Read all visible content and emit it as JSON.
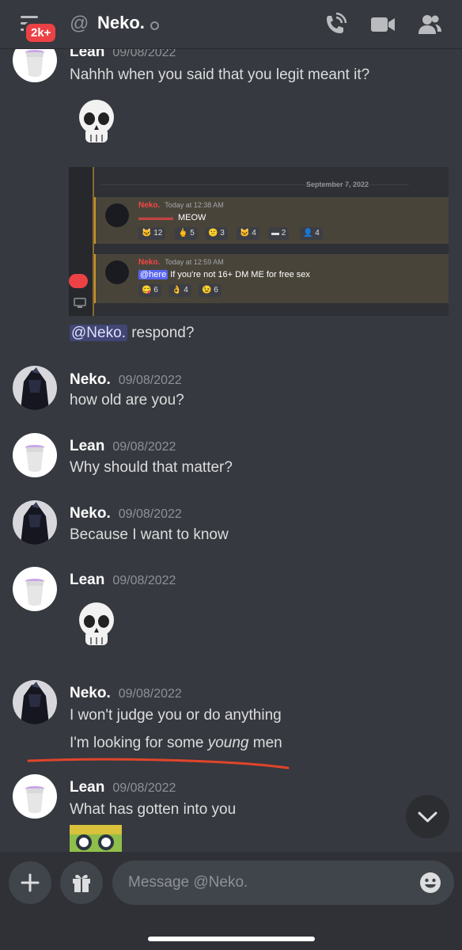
{
  "header": {
    "badge": "2k+",
    "channel_name": "Neko."
  },
  "messages": [
    {
      "author": "Lean",
      "timestamp": "09/08/2022",
      "lines": [
        "Nahhh when you said that you legit meant it?"
      ]
    },
    {
      "mention": "@Neko.",
      "text": " respond?"
    },
    {
      "author": "Neko.",
      "timestamp": "09/08/2022",
      "lines": [
        "how old are you?"
      ]
    },
    {
      "author": "Lean",
      "timestamp": "09/08/2022",
      "lines": [
        "Why should that matter?"
      ]
    },
    {
      "author": "Neko.",
      "timestamp": "09/08/2022",
      "lines": [
        "Because I want to know"
      ]
    },
    {
      "author": "Lean",
      "timestamp": "09/08/2022",
      "lines": []
    },
    {
      "author": "Neko.",
      "timestamp": "09/08/2022",
      "lines": [
        "I won't judge you or do anything"
      ],
      "line2_pre": "I'm looking for some ",
      "line2_em": "young",
      "line2_post": " men"
    },
    {
      "author": "Lean",
      "timestamp": "09/08/2022",
      "lines": [
        "What has gotten into you"
      ]
    }
  ],
  "embedded_screenshot": {
    "date_divider": "September 7, 2022",
    "posts": [
      {
        "author": "Neko.",
        "time": "Today at 12:38 AM",
        "text": "MEOW",
        "reactions": [
          "12",
          "5",
          "3",
          "4",
          "2",
          "4"
        ]
      },
      {
        "author": "Neko.",
        "time": "Today at 12:59 AM",
        "mention": "@here",
        "text": " If you're not 16+ DM ME for free sex",
        "reactions": [
          "6",
          "4",
          "6"
        ]
      }
    ]
  },
  "composer": {
    "placeholder": "Message @Neko."
  },
  "colors": {
    "background": "#36393f",
    "mention_bg": "#414675",
    "badge": "#ed4245",
    "underline": "#e0452b"
  }
}
